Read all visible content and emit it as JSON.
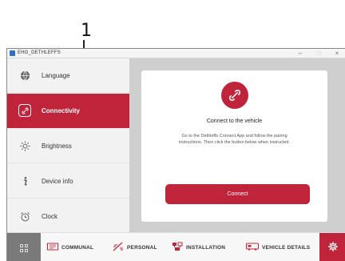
{
  "callout": {
    "number": "1"
  },
  "window": {
    "title": "EHG_DETHLEFFS",
    "controls": {
      "minimize": "–",
      "maximize": "□",
      "close": "×"
    }
  },
  "sidebar": {
    "items": [
      {
        "label": "Language",
        "icon": "globe-icon",
        "active": false
      },
      {
        "label": "Connectivity",
        "icon": "link-icon",
        "active": true
      },
      {
        "label": "Brightness",
        "icon": "sun-icon",
        "active": false
      },
      {
        "label": "Device info",
        "icon": "info-icon",
        "active": false
      },
      {
        "label": "Clock",
        "icon": "alarm-clock-icon",
        "active": false
      }
    ]
  },
  "card": {
    "icon": "link-icon",
    "title": "Connect to the vehicle",
    "body": "Go to the Dethleffs Connect App and follow the pairing instructions. Then click the button below when instructed.",
    "button_label": "Connect"
  },
  "bottom_nav": {
    "tabs": [
      {
        "label": "COMMUNAL",
        "icon": "communal-icon"
      },
      {
        "label": "PERSONAL",
        "icon": "personal-icon"
      },
      {
        "label": "INSTALLATION",
        "icon": "installation-icon"
      },
      {
        "label": "VEHICLE DETAILS",
        "icon": "vehicle-icon"
      }
    ],
    "settings_icon": "gear-icon"
  },
  "colors": {
    "accent": "#c0243b",
    "content_bg": "#cfcfcf",
    "sidebar_bg": "#f2f2f2"
  }
}
